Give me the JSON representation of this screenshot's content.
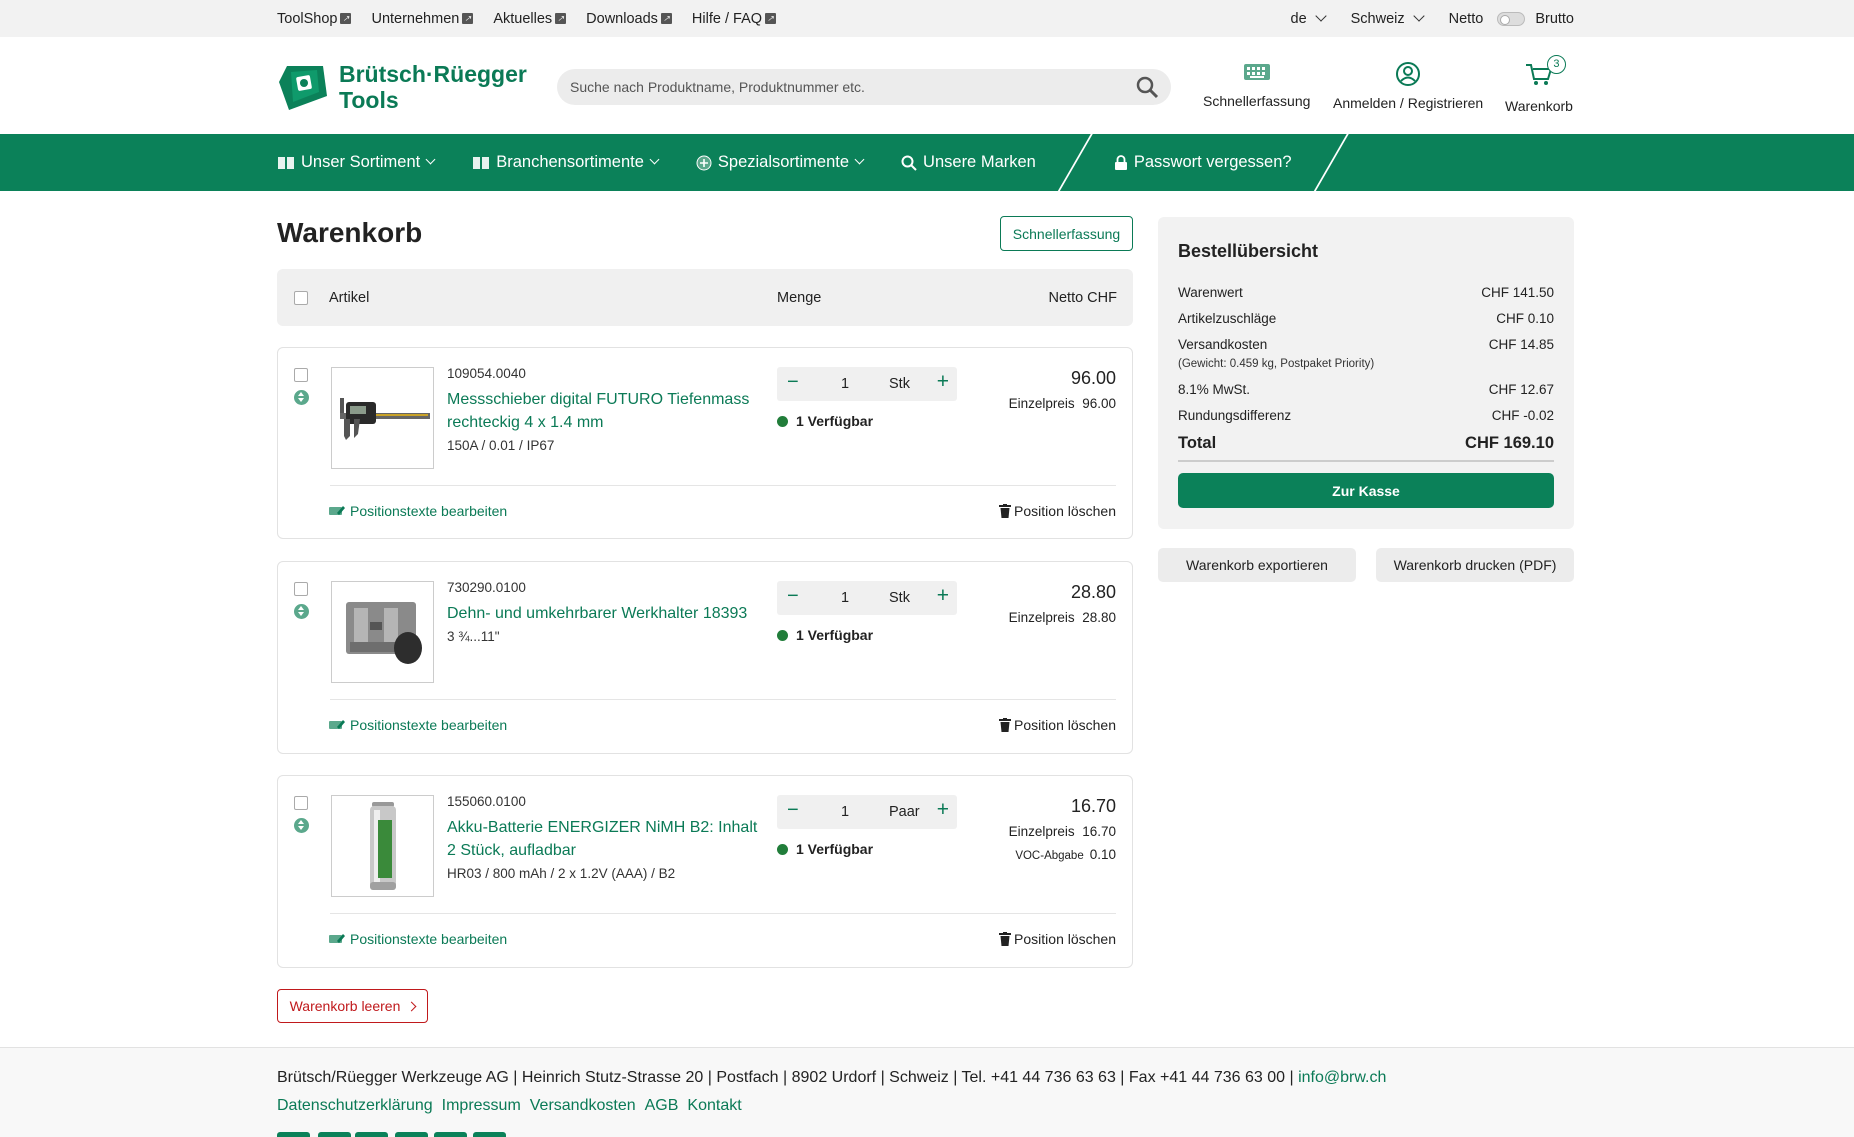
{
  "topbar": {
    "links": [
      "ToolShop",
      "Unternehmen",
      "Aktuelles",
      "Downloads",
      "Hilfe / FAQ"
    ],
    "language": "de",
    "country": "Schweiz",
    "price_mode_left": "Netto",
    "price_mode_right": "Brutto"
  },
  "header": {
    "logo_line1": "Brütsch·Rüegger",
    "logo_line2": "Tools",
    "search_placeholder": "Suche nach Produktname, Produktnummer etc.",
    "quick_entry": "Schnellerfassung",
    "login": "Anmelden / Registrieren",
    "cart": "Warenkorb",
    "cart_count": "3"
  },
  "nav": {
    "items": [
      "Unser Sortiment",
      "Branchensortimente",
      "Spezialsortimente",
      "Unsere Marken",
      "Passwort vergessen?"
    ]
  },
  "cart": {
    "title": "Warenkorb",
    "quick_entry_button": "Schnellerfassung",
    "columns": {
      "article": "Artikel",
      "quantity": "Menge",
      "net": "Netto CHF"
    },
    "edit_label": "Positionstexte bearbeiten",
    "delete_label": "Position löschen",
    "unit_price_label": "Einzelpreis",
    "items": [
      {
        "sku": "109054.0040",
        "name": "Messschieber digital FUTURO Tiefenmass rechteckig 4 x 1.4 mm",
        "desc": "150A / 0.01 / IP67",
        "qty": "1",
        "unit": "Stk",
        "availability": "1 Verfügbar",
        "price": "96.00",
        "unit_price": "96.00"
      },
      {
        "sku": "730290.0100",
        "name": "Dehn- und umkehrbarer Werkhalter 18393",
        "desc": "3 ¾...11\"",
        "qty": "1",
        "unit": "Stk",
        "availability": "1 Verfügbar",
        "price": "28.80",
        "unit_price": "28.80"
      },
      {
        "sku": "155060.0100",
        "name": "Akku-Batterie ENERGIZER NiMH B2: Inhalt 2 Stück, aufladbar",
        "desc": "HR03 / 800 mAh / 2 x 1.2V (AAA) / B2",
        "qty": "1",
        "unit": "Paar",
        "availability": "1 Verfügbar",
        "price": "16.70",
        "unit_price": "16.70",
        "voc_label": "VOC-Abgabe",
        "voc": "0.10"
      }
    ],
    "clear_button": "Warenkorb leeren"
  },
  "summary": {
    "title": "Bestellübersicht",
    "rows": [
      {
        "label": "Warenwert",
        "value": "CHF 141.50"
      },
      {
        "label": "Artikelzuschläge",
        "value": "CHF 0.10"
      },
      {
        "label": "Versandkosten",
        "value": "CHF 14.85"
      },
      {
        "label": "8.1% MwSt.",
        "value": "CHF 12.67"
      },
      {
        "label": "Rundungsdifferenz",
        "value": "CHF -0.02"
      }
    ],
    "shipping_note": "(Gewicht: 0.459 kg, Postpaket Priority)",
    "total_label": "Total",
    "total_value": "CHF 169.10",
    "checkout": "Zur Kasse",
    "export": "Warenkorb exportieren",
    "print": "Warenkorb drucken (PDF)"
  },
  "footer": {
    "address": "Brütsch/Rüegger Werkzeuge AG | Heinrich Stutz-Strasse 20 | Postfach | 8902 Urdorf | Schweiz | Tel. +41 44 736 63 63 | Fax +41 44 736 63 00 | ",
    "email": "info@brw.ch",
    "links": [
      "Datenschutzerklärung",
      "Impressum",
      "Versandkosten",
      "AGB",
      "Kontakt"
    ]
  },
  "colors": {
    "brand": "#0b8159",
    "danger": "#c0191c"
  }
}
